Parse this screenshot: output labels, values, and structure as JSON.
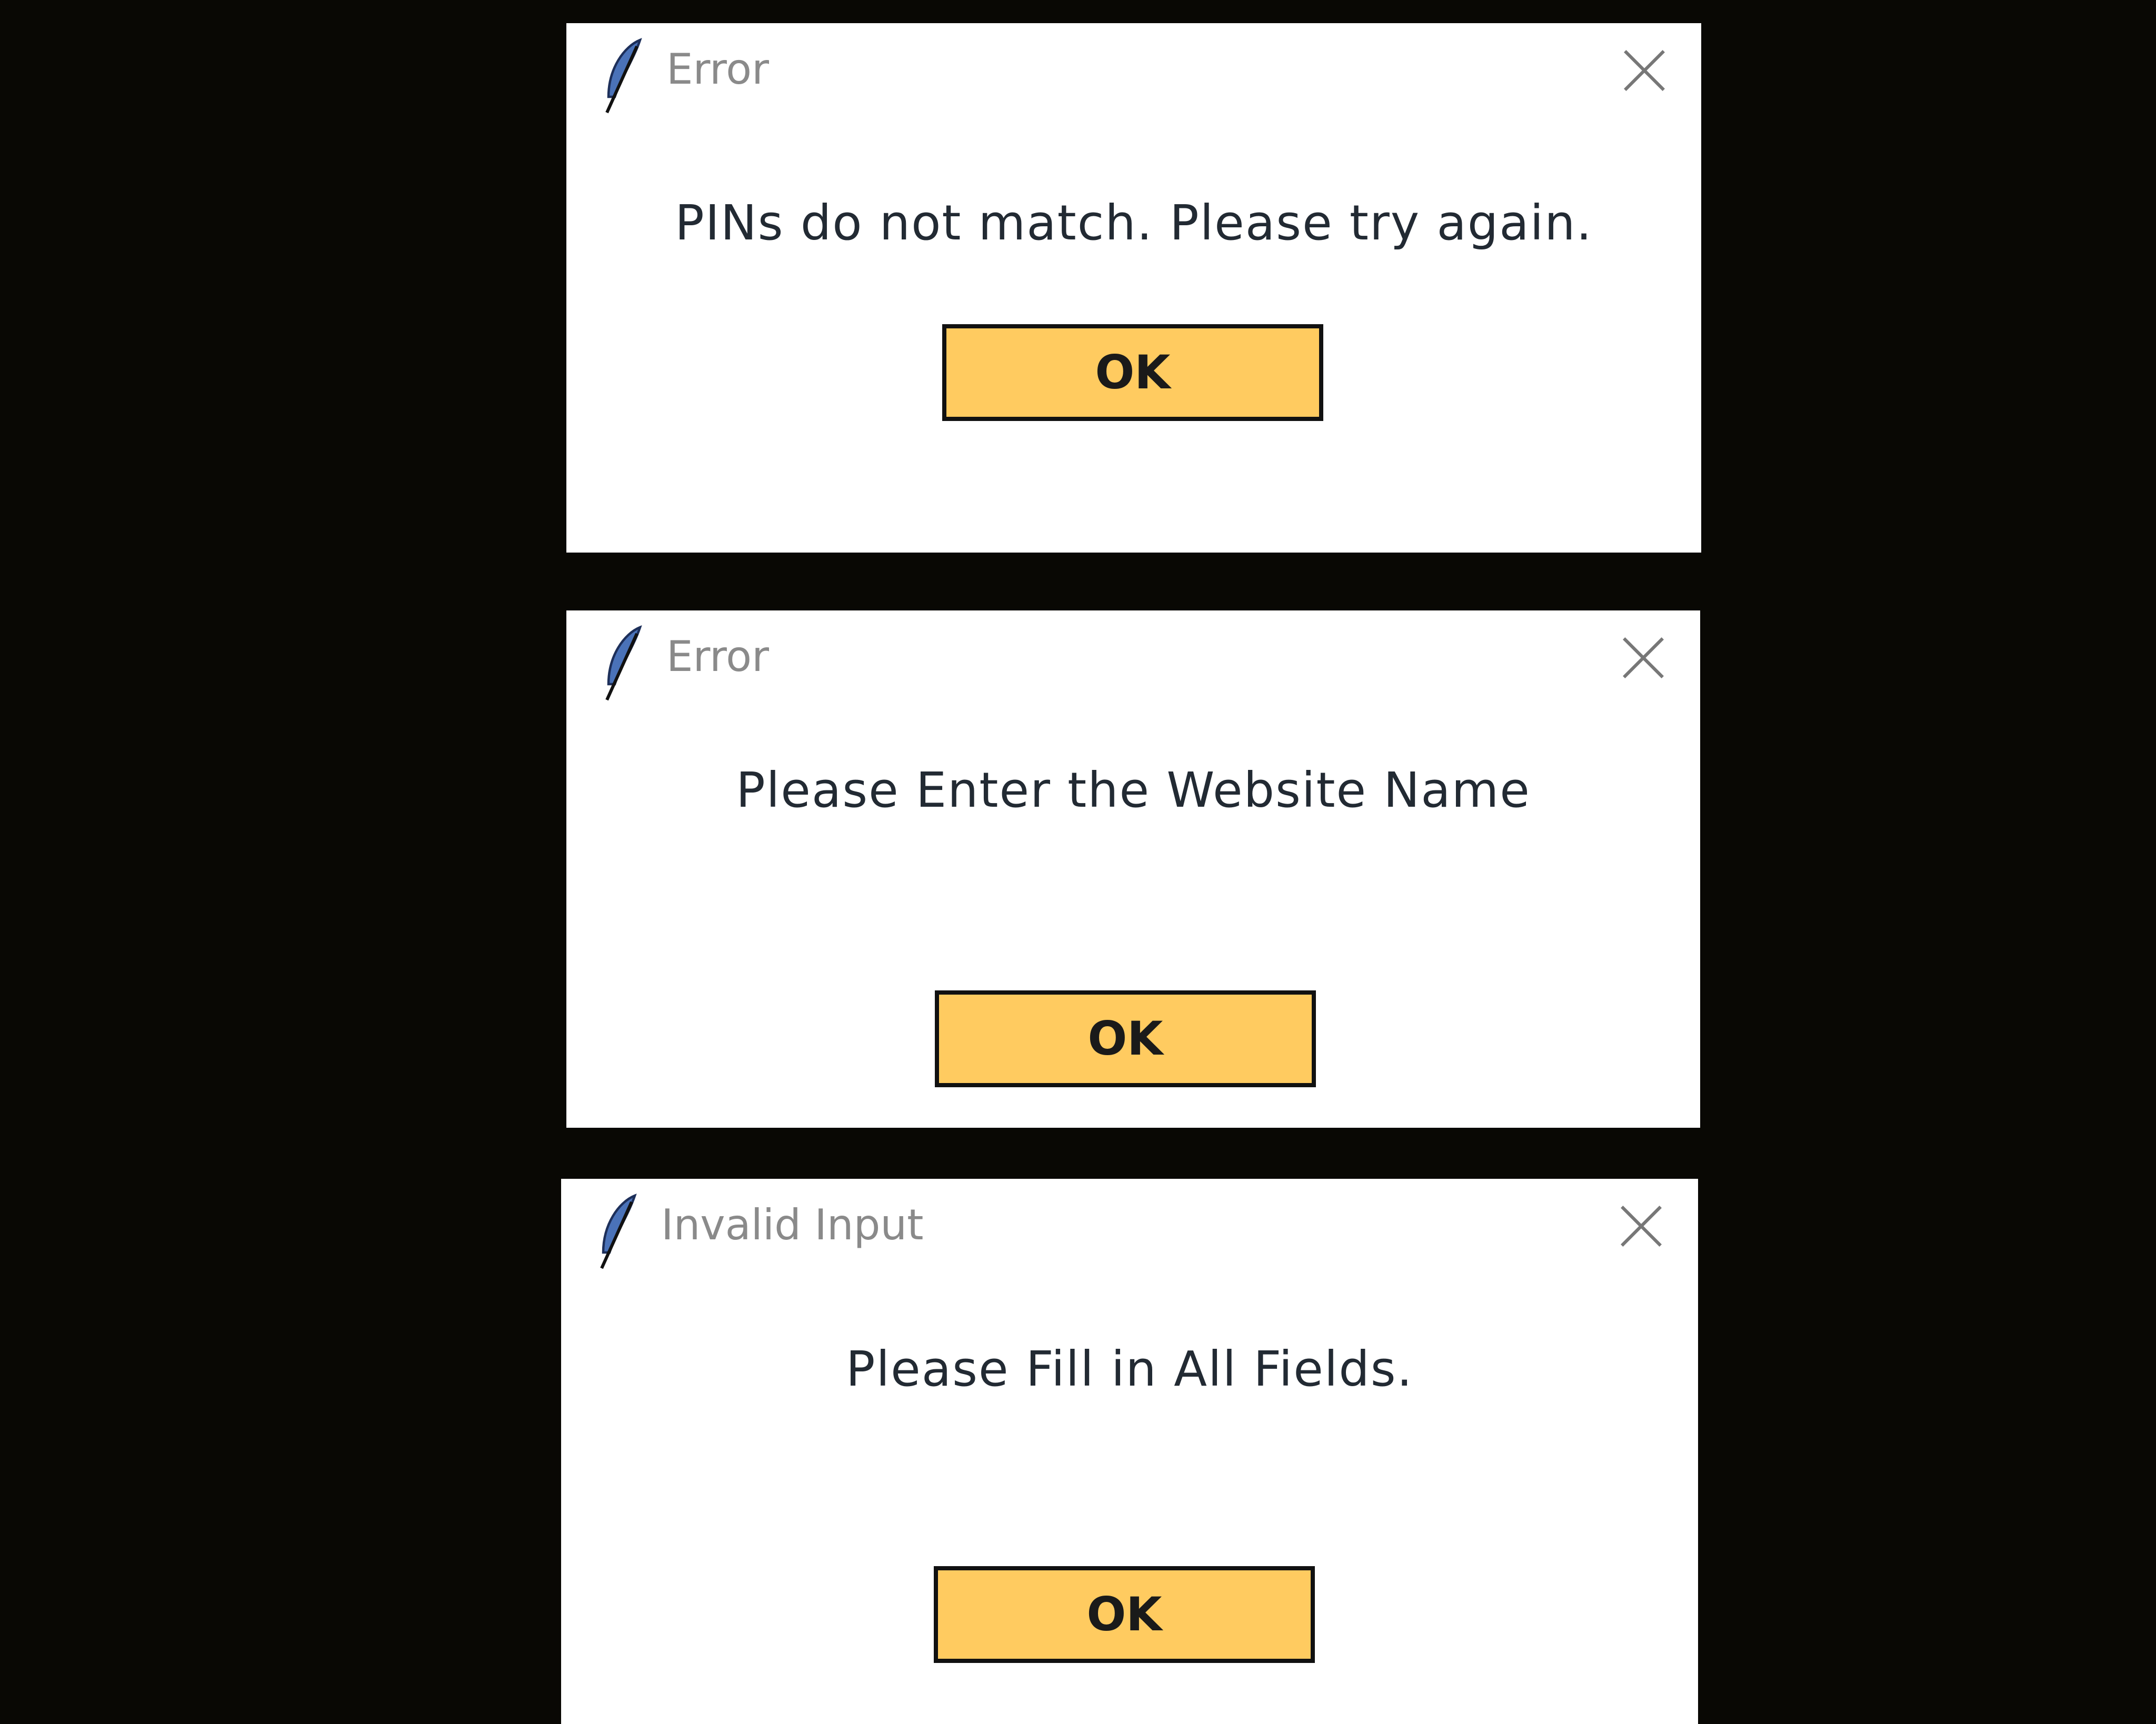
{
  "colors": {
    "background": "#090804",
    "dialog_background": "#ffffff",
    "button_fill": "#ffcb60",
    "button_border": "#111111",
    "title_text": "#8a8a8a",
    "message_text": "#222a33"
  },
  "dialogs": [
    {
      "title": "Error",
      "icon": "feather-icon",
      "message": "PINs do not match. Please try again.",
      "ok_label": "OK"
    },
    {
      "title": "Error",
      "icon": "feather-icon",
      "message": "Please Enter the Website Name",
      "ok_label": "OK"
    },
    {
      "title": "Invalid Input",
      "icon": "feather-icon",
      "message": "Please Fill in All Fields.",
      "ok_label": "OK"
    }
  ]
}
